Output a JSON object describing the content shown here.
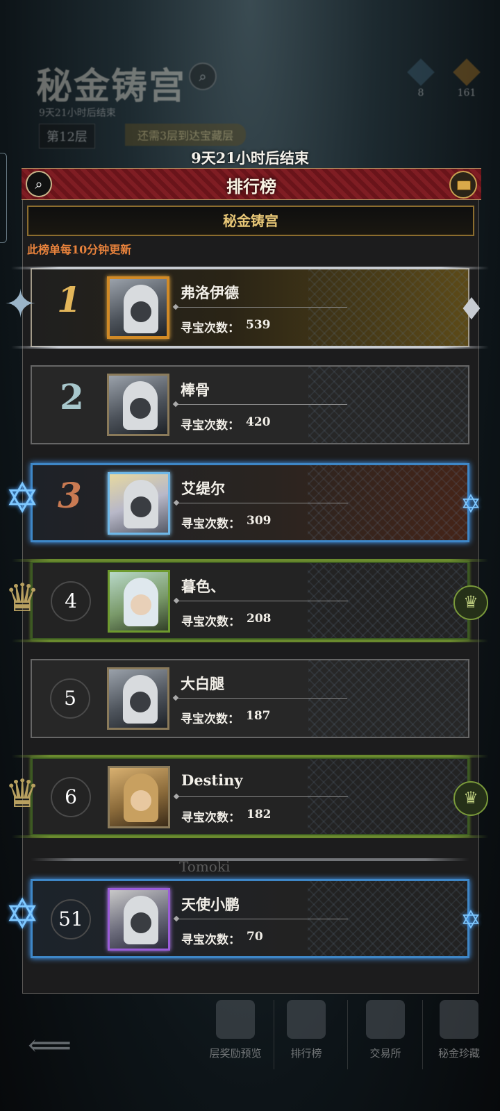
{
  "background": {
    "title": "秘金铸宫",
    "subtitle": "9天21小时后结束",
    "layer": "第12层",
    "hint": "还需3层到达宝藏层",
    "currency1": "8",
    "currency2": "161"
  },
  "countdown": "9天21小时后结束",
  "panel": {
    "title": "排行榜",
    "category": "秘金铸宫",
    "update_note": "此榜单每10分钟更新"
  },
  "rows": [
    {
      "rank": "1",
      "name": "弗洛伊德",
      "label": "寻宝次数：",
      "value": "539"
    },
    {
      "rank": "2",
      "name": "棒骨",
      "label": "寻宝次数：",
      "value": "420"
    },
    {
      "rank": "3",
      "name": "艾缇尔",
      "label": "寻宝次数：",
      "value": "309"
    },
    {
      "rank": "4",
      "name": "暮色、",
      "label": "寻宝次数：",
      "value": "208"
    },
    {
      "rank": "5",
      "name": "大白腿",
      "label": "寻宝次数：",
      "value": "187"
    },
    {
      "rank": "6",
      "name": "Destiny",
      "label": "寻宝次数：",
      "value": "182"
    }
  ],
  "partial_row_name": "Tomoki",
  "my_row": {
    "rank": "51",
    "name": "天使小鹏",
    "label": "寻宝次数：",
    "value": "70"
  },
  "bottom_nav": [
    {
      "label": "层奖励预览"
    },
    {
      "label": "排行榜"
    },
    {
      "label": "交易所"
    },
    {
      "label": "秘金珍藏"
    }
  ],
  "icons": {
    "search": "search-icon",
    "chest": "chest-icon",
    "back": "back-arrow-icon"
  },
  "colors": {
    "header_red": "#7f1d23",
    "gold_text": "#e8c777",
    "note_orange": "#e8823c",
    "highlight_blue": "#3e87c7"
  }
}
